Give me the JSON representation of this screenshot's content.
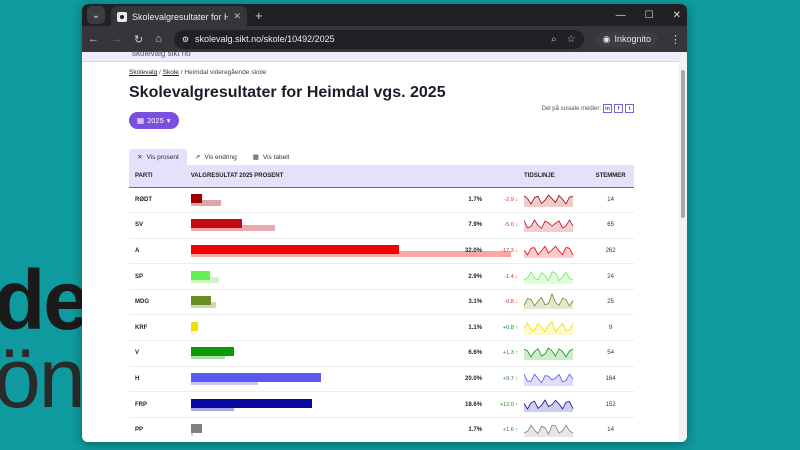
{
  "background_text": [
    "dela",
    "önde"
  ],
  "browser": {
    "tab_title": "Skolevalgresultater for Heimdal",
    "url": "skolevalg.sikt.no/skole/10492/2025",
    "incognito_label": "Inkognito",
    "site_logo_remnant": "skolevalg sikt no"
  },
  "breadcrumb": {
    "items": [
      "Skolevalg",
      "Skole",
      "Heimdal videregående skole"
    ],
    "separator": "/"
  },
  "page": {
    "title": "Skolevalgresultater for Heimdal vgs. 2025",
    "share_label": "Del på sosiale medier:",
    "share_buttons": [
      "in",
      "f",
      "t"
    ],
    "year_button": "2025"
  },
  "view_tabs": [
    {
      "label": "Vis prosent",
      "icon": "percent-icon",
      "active": true
    },
    {
      "label": "Vis endring",
      "icon": "chart-icon",
      "active": false
    },
    {
      "label": "Vis tabell",
      "icon": "table-icon",
      "active": false
    }
  ],
  "table": {
    "headers": {
      "party": "PARTI",
      "result": "VALGRESULTAT 2025 PROSENT",
      "timeline": "TIDSLINJE",
      "votes": "STEMMER"
    },
    "rows": [
      {
        "party": "RØDT",
        "pct": "1.7%",
        "change": "-2.9",
        "dir": "down",
        "votes": "14",
        "color": "#a00000",
        "value": 1.7,
        "prev": 4.6
      },
      {
        "party": "SV",
        "pct": "7.9%",
        "change": "-5.0",
        "dir": "down",
        "votes": "65",
        "color": "#c40a10",
        "value": 7.9,
        "prev": 12.9
      },
      {
        "party": "A",
        "pct": "32.0%",
        "change": "-17.3",
        "dir": "down",
        "votes": "262",
        "color": "#f00000",
        "value": 32.0,
        "prev": 49.3
      },
      {
        "party": "SP",
        "pct": "2.9%",
        "change": "-1.4",
        "dir": "down",
        "votes": "24",
        "color": "#66ee55",
        "value": 2.9,
        "prev": 4.3
      },
      {
        "party": "MDG",
        "pct": "3.1%",
        "change": "-0.8",
        "dir": "down",
        "votes": "25",
        "color": "#6b8e23",
        "value": 3.1,
        "prev": 3.9
      },
      {
        "party": "KRF",
        "pct": "1.1%",
        "change": "+0.8",
        "dir": "up",
        "votes": "9",
        "color": "#f0e000",
        "value": 1.1,
        "prev": 0.3
      },
      {
        "party": "V",
        "pct": "6.6%",
        "change": "+1.3",
        "dir": "up",
        "votes": "54",
        "color": "#0a9a0a",
        "value": 6.6,
        "prev": 5.3
      },
      {
        "party": "H",
        "pct": "20.0%",
        "change": "+9.7",
        "dir": "up",
        "votes": "164",
        "color": "#5a5af0",
        "value": 20.0,
        "prev": 10.3
      },
      {
        "party": "FRP",
        "pct": "18.6%",
        "change": "+12.0",
        "dir": "up",
        "votes": "152",
        "color": "#0a0aa0",
        "value": 18.6,
        "prev": 6.6
      },
      {
        "party": "PP",
        "pct": "1.7%",
        "change": "+1.6",
        "dir": "up",
        "votes": "14",
        "color": "#808080",
        "value": 1.7,
        "prev": 0.1
      }
    ]
  }
}
